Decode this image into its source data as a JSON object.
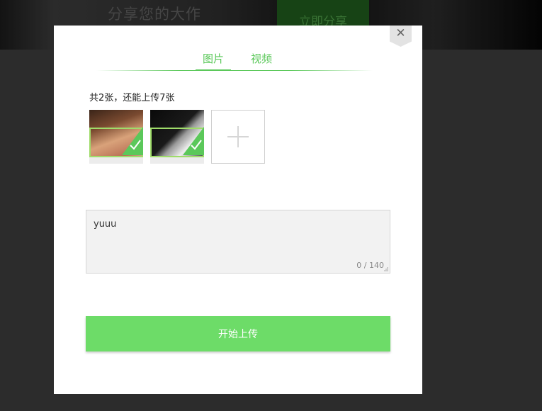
{
  "background": {
    "header_title": "分享您的大作",
    "share_button_label": "立即分享"
  },
  "modal": {
    "close_label": "✕",
    "tabs": [
      {
        "label": "图片",
        "active": true
      },
      {
        "label": "视频",
        "active": false
      }
    ],
    "upload_summary": "共2张，还能上传7张",
    "thumbnails": [
      {
        "selected": true
      },
      {
        "selected": true
      }
    ],
    "description": {
      "value": "yuuu",
      "counter": "0 / 140"
    },
    "submit_label": "开始上传"
  },
  "colors": {
    "accent": "#5bc85a",
    "button": "#6ddc68",
    "overlay": "#3b3b3b"
  },
  "icons": {
    "close": "close-icon",
    "check": "checkmark-icon",
    "add": "plus-icon"
  }
}
